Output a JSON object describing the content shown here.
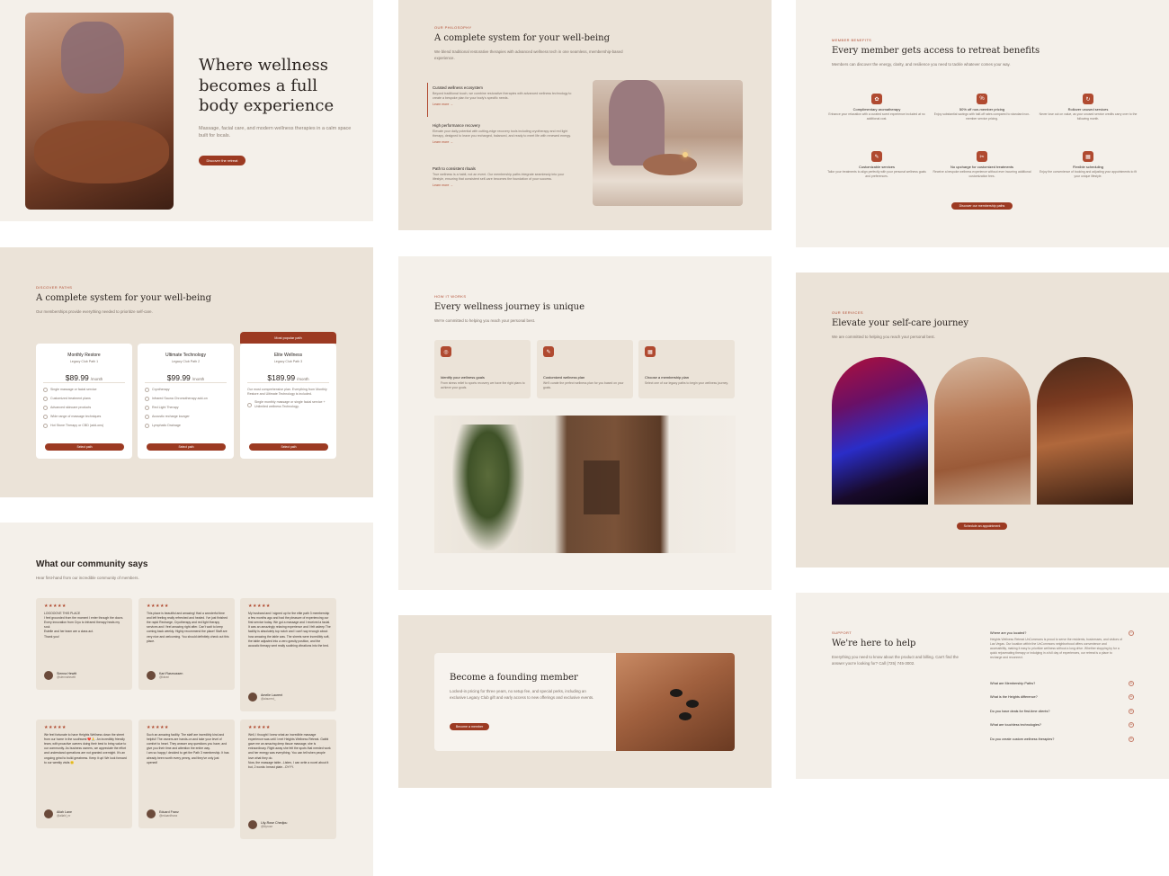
{
  "hero": {
    "title": "Where wellness becomes a full body experience",
    "subtitle": "Massage, facial care, and modern wellness therapies in a calm space built for locals.",
    "cta": "Discover the retreat"
  },
  "philosophy": {
    "eyebrow": "OUR PHILOSOPHY",
    "title": "A complete system for your well-being",
    "desc": "We blend traditional restorative therapies with advanced wellness tech in one seamless, membership-based experience.",
    "items": [
      {
        "title": "Curated wellness ecosystem",
        "text": "Beyond traditional touch, we combine restorative therapies with advanced wellness technology to create a bespoke plan for your body's specific needs.",
        "link": "Learn more →"
      },
      {
        "title": "High performance recovery",
        "text": "Elevate your daily potential with cutting-edge recovery tools including cryotherapy and red light therapy, designed to leave you recharged, balanced, and ready to meet life with renewed energy.",
        "link": "Learn more →"
      },
      {
        "title": "Path to consistent rituals",
        "text": "True wellness is a habit, not an event. Our membership paths integrate seamlessly into your lifestyle, ensuring that consistent self-care becomes the foundation of your success.",
        "link": "Learn more →"
      }
    ]
  },
  "benefits": {
    "eyebrow": "MEMBER BENEFITS",
    "title": "Every member gets access to retreat benefits",
    "desc": "Members can discover the energy, clarity, and resilience you need to tackle whatever comes your way.",
    "items": [
      {
        "title": "Complimentary aromatherapy",
        "text": "Enhance your relaxation with a curated scent experience included at no additional cost."
      },
      {
        "title": "50% off non-member pricing",
        "text": "Enjoy substantial savings with half-off rates compared to standard non-member service pricing."
      },
      {
        "title": "Rollover unused services",
        "text": "Never lose out on value, as your unused service credits carry over to the following month."
      },
      {
        "title": "Customizable services",
        "text": "Tailor your treatments to align perfectly with your personal wellness goals and preferences."
      },
      {
        "title": "No upcharge for customized treatments",
        "text": "Receive a bespoke wellness experience without ever incurring additional customization fees."
      },
      {
        "title": "Flexible scheduling",
        "text": "Enjoy the convenience of booking and adjusting your appointments to fit your unique lifestyle."
      }
    ],
    "cta": "Discover our membership paths"
  },
  "paths": {
    "eyebrow": "DISCOVER PATHS",
    "title": "A complete system for your well-being",
    "desc": "Our memberships provide everything needed to prioritize self-care.",
    "badge": "Most popular path",
    "plans": [
      {
        "name": "Monthly Restore",
        "sub": "Legacy Club Path 1",
        "price": "$89.99",
        "per": "/month",
        "features": [
          "Single massage or facial service",
          "Customized treatment plans",
          "Advanced skincare products",
          "Wide range of massage techniques",
          "Hot Stone Therapy or CBD (add-ons)"
        ],
        "cta": "Select path"
      },
      {
        "name": "Ultimate Technology",
        "sub": "Legacy Club Path 2",
        "price": "$99.99",
        "per": "/month",
        "features": [
          "Cryotherapy",
          "Infrared Sauna Chromotherapy add-on",
          "Red Light Therapy",
          "Acoustic recharge lounger",
          "Lymphatic Drainage"
        ],
        "cta": "Select path"
      },
      {
        "name": "Elite Wellness",
        "sub": "Legacy Club Path 3",
        "price": "$189.99",
        "per": "/month",
        "intro": "Our most comprehensive plan. Everything from Monthly Restore and Ultimate Technology is included.",
        "features": [
          "Single monthly massage or single facial service + Unlimited wellness Technology."
        ],
        "cta": "Select path"
      }
    ]
  },
  "how": {
    "eyebrow": "HOW IT WORKS",
    "title": "Every wellness journey is unique",
    "desc": "We're committed to helping you reach your personal best.",
    "steps": [
      {
        "title": "Identify your wellness goals",
        "text": "From stress relief to sports recovery we have the right plans to achieve your goals."
      },
      {
        "title": "Customized wellness plan",
        "text": "We'll curate the perfect wellness plan for you based on your goals."
      },
      {
        "title": "Choose a membership plan",
        "text": "Select one of our legacy paths to begin your wellness journey."
      }
    ]
  },
  "services": {
    "eyebrow": "OUR SERVICES",
    "title": "Elevate your self-care journey",
    "desc": "We are committed to helping you reach your personal best.",
    "cta": "Schedule an appointment"
  },
  "testimonials": {
    "title": "What our community says",
    "desc": "Hear first-hand from our incredible community of members.",
    "stars": "★★★★★",
    "items": [
      {
        "text": "LOOOOOVE THIS PLACE\nI feel grounded from the moment I enter through the doors. Every innovation from Cryo to Infrared therapy heals my soul.\nEstelle and her team are a class act.\nThank you!",
        "name": "Sienna Hewitt",
        "handle": "@siennahewitt"
      },
      {
        "text": "This place is beautiful and amazing! Had a wonderful time and left feeling really refreshed and healed. I've just finished the rapid Recharge, Cryotherapy and red light therapy services and I feel amazing right after. Can't wait to keep coming back weekly. Highly recommend the place! Staff are very nice and welcoming. You should definitely check out this place.",
        "name": "Kari Rasmussen",
        "handle": "@kkrari"
      },
      {
        "text": "My husband and I signed up for the elite path 3 membership a few months ago and had the pleasure of experiencing our first service today. We got a massage and I received a facial. It was an amazingly relaxing experience and I felt asleep The facility is absolutely top notch and I can't say enough about how amazing the table was. The sheets were incredibly soft, the table adjusted into a zero gravity position, and the acoustic therapy sent really soothing vibrations into the bed.",
        "name": "Amelie Laurent",
        "handle": "@alaurent_"
      },
      {
        "text": "We feel fortunate to have Heights Wellness down the street from our home in the southwest ❤️🙏. An incredibly friendly team, with proactive owners doing their best to bring value to our community. As business owners, we appreciate the effort and understand operations are not granted overnight. It's an ongoing grind to build greatness. Keep it up! We look forward to our weekly visits 🙂",
        "name": "Ailah Lane",
        "handle": "@ailahl_nr"
      },
      {
        "text": "Such an amazing facility. The staff are incredibly kind and helpful! The owners are hands-on and take your level of comfort to heart. They answer any questions you have, and give you their time and attention the entire way.\nI am so happy I decided to get the Path 3 membership. It has already been worth every penny, and they've only just opened!",
        "name": "Eduard Franz",
        "handle": "@eduardfranz"
      },
      {
        "text": "Well, I thought I knew what an incredible massage experience was until I met Heights Wellness Retreat. Gabbi gave me an amazing deep tissue massage, she is extraordinary. Right away she felt the spots that needed work and her energy was everything. You can tell when people love what they do.\nNow, the massage table...Listen, I can write a novel about it but, 2 words: breast plate...OYYY.",
        "name": "Lily-Rose Chedjou",
        "handle": "@lilyrose"
      }
    ]
  },
  "founding": {
    "title": "Become a founding member",
    "desc": "Locked-in pricing for three years, no setup fee, and special perks, including an exclusive Legacy Club gift and early access to new offerings and exclusive events.",
    "cta": "Become a member"
  },
  "support": {
    "eyebrow": "SUPPORT",
    "title": "We're here to help",
    "desc": "Everything you need to know about the product and billing. Can't find the answer you're looking for? Call (725) 745-3002.",
    "faqs": [
      {
        "q": "Where are you located?",
        "a": "Heights Wellness Retreat UnCommons is proud to serve the residents, businesses, and visitors of Las Vegas. Our location within the UnCommons neighborhood offers convenience and accessibility, making it easy to prioritize wellness without a long drive. Whether stopping by for a quick rejuvenating therapy or indulging in a full day of experiences, our retreat is a place to recharge and reconnect."
      },
      {
        "q": "What are Membership Paths?"
      },
      {
        "q": "What is the Heights difference?"
      },
      {
        "q": "Do you have deals for first-time clients?"
      },
      {
        "q": "What are touchless technologies?"
      },
      {
        "q": "Do you create custom wellness therapies?"
      }
    ]
  },
  "colors": {
    "accent": "#9c3a22",
    "bg_light": "#f4f0ea",
    "bg_warm": "#ebe3d8"
  }
}
